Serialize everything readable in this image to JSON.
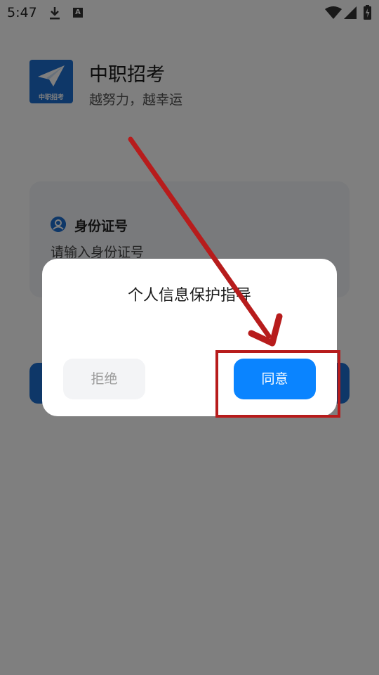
{
  "status_bar": {
    "time": "5:47",
    "icons": [
      "download-icon",
      "a-icon",
      "wifi-icon",
      "signal-icon",
      "battery-icon"
    ]
  },
  "app": {
    "name": "中职招考",
    "slogan": "越努力，越幸运",
    "logo_text": "中职招考",
    "brand_color": "#1c6fd1"
  },
  "form": {
    "id_label": "身份证号",
    "id_placeholder": "请输入身份证号"
  },
  "dialog": {
    "title": "个人信息保护指导",
    "reject_label": "拒绝",
    "agree_label": "同意",
    "agree_color": "#0a84ff"
  },
  "annotation": {
    "color": "#b71c1c"
  }
}
